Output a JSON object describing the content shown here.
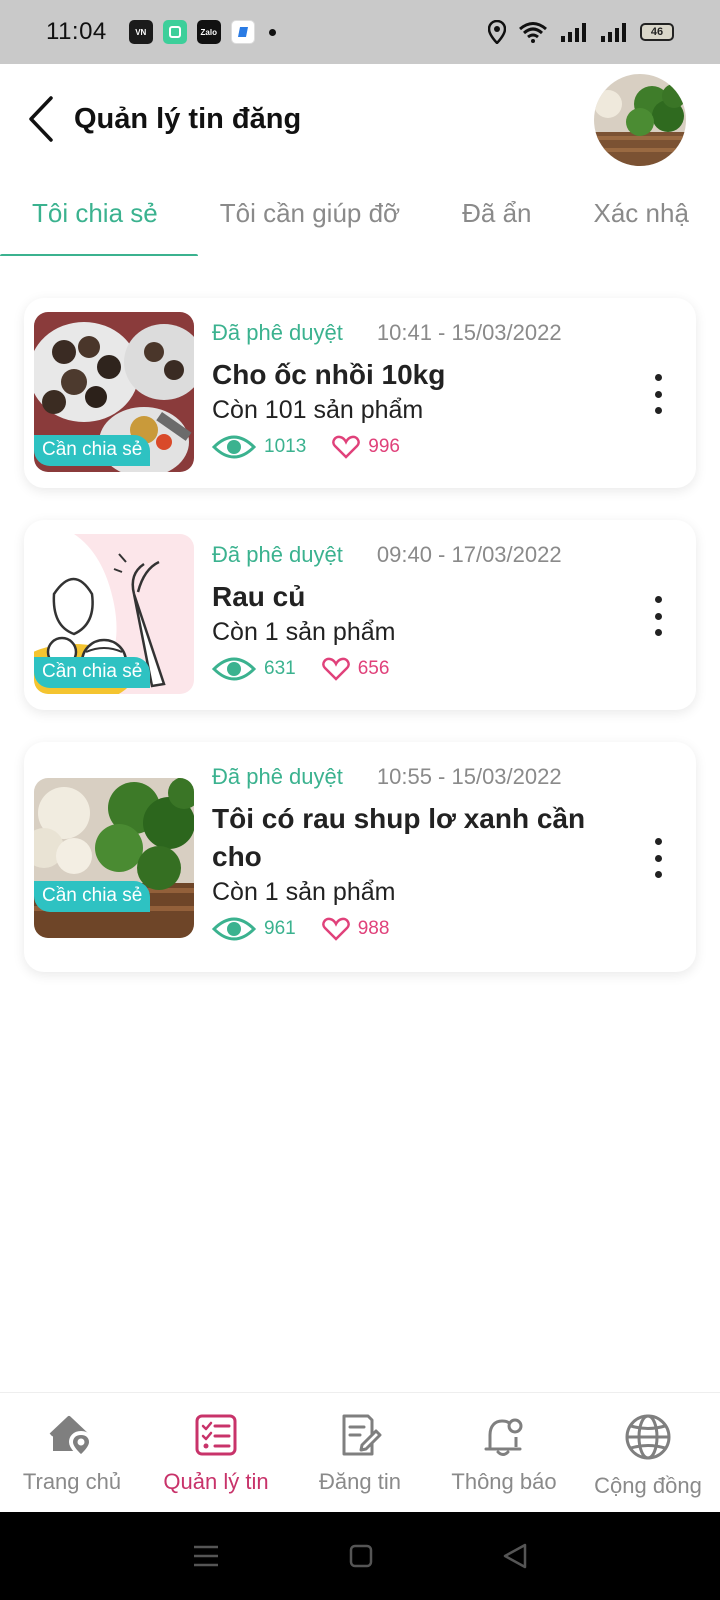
{
  "status_bar": {
    "time": "11:04",
    "battery": "46",
    "app_icons": [
      "vn-app-icon",
      "green-app-icon",
      "zalo-icon",
      "blue-app-icon"
    ]
  },
  "header": {
    "title": "Quản lý tin đăng"
  },
  "tabs": [
    {
      "label": "Tôi chia sẻ",
      "active": true
    },
    {
      "label": "Tôi cần giúp đỡ",
      "active": false
    },
    {
      "label": "Đã ẩn",
      "active": false
    },
    {
      "label": "Xác nhậ",
      "active": false
    }
  ],
  "posts": [
    {
      "status": "Đã phê duyệt",
      "time": "10:41 - 15/03/2022",
      "title": "Cho ốc nhồi 10kg",
      "remaining": "Còn 101 sản phẩm",
      "views": "1013",
      "likes": "996",
      "badge": "Cần chia sẻ"
    },
    {
      "status": "Đã phê duyệt",
      "time": "09:40 - 17/03/2022",
      "title": "Rau củ",
      "remaining": "Còn 1 sản phẩm",
      "views": "631",
      "likes": "656",
      "badge": "Cần chia sẻ"
    },
    {
      "status": "Đã phê duyệt",
      "time": "10:55 - 15/03/2022",
      "title": "Tôi có rau shup lơ xanh cần cho",
      "remaining": "Còn 1 sản phẩm",
      "views": "961",
      "likes": "988",
      "badge": "Cần chia sẻ"
    }
  ],
  "bottom_nav": [
    {
      "label": "Trang chủ",
      "icon": "home-location-icon",
      "active": false
    },
    {
      "label": "Quản lý tin",
      "icon": "checklist-icon",
      "active": true
    },
    {
      "label": "Đăng tin",
      "icon": "edit-document-icon",
      "active": false
    },
    {
      "label": "Thông báo",
      "icon": "bell-icon",
      "active": false
    },
    {
      "label": "Cộng đồng",
      "icon": "globe-icon",
      "active": false
    }
  ],
  "colors": {
    "accent_green": "#3bb28f",
    "accent_pink": "#c8336a",
    "badge_teal": "#2ec2c2",
    "likes_pink": "#e0417a"
  }
}
